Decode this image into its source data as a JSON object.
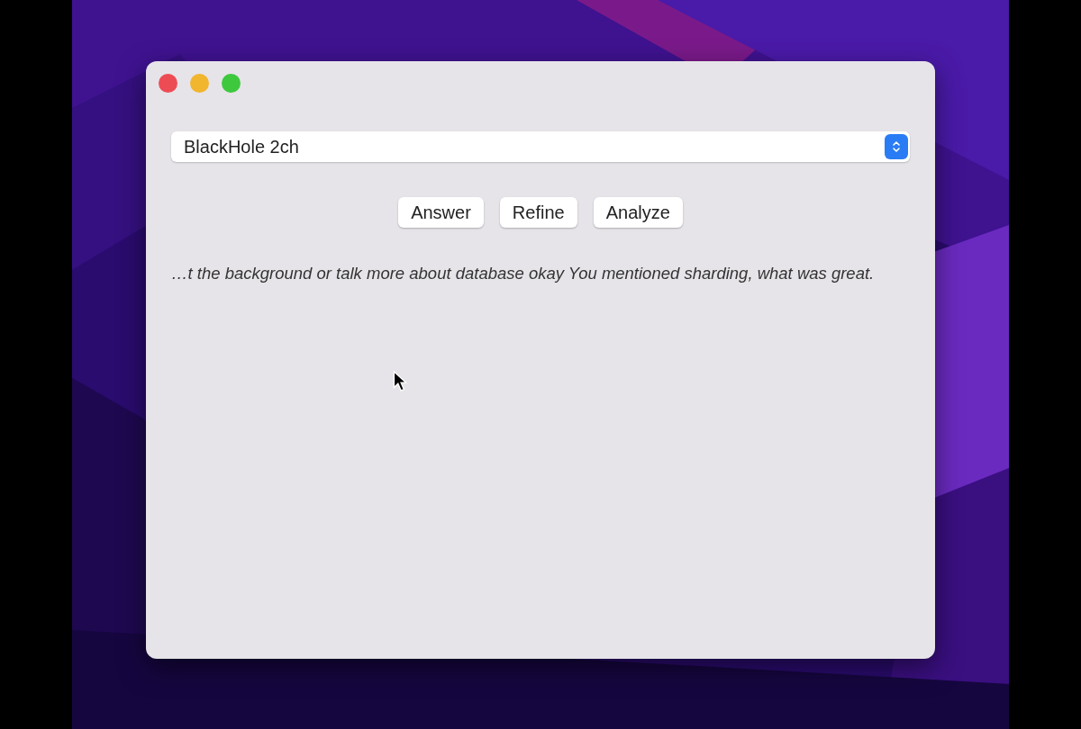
{
  "device_popup": {
    "value": "BlackHole 2ch"
  },
  "buttons": [
    {
      "label": "Answer"
    },
    {
      "label": "Refine"
    },
    {
      "label": "Analyze"
    }
  ],
  "transcript": "…t the background or talk more about database okay You mentioned sharding, what was great."
}
